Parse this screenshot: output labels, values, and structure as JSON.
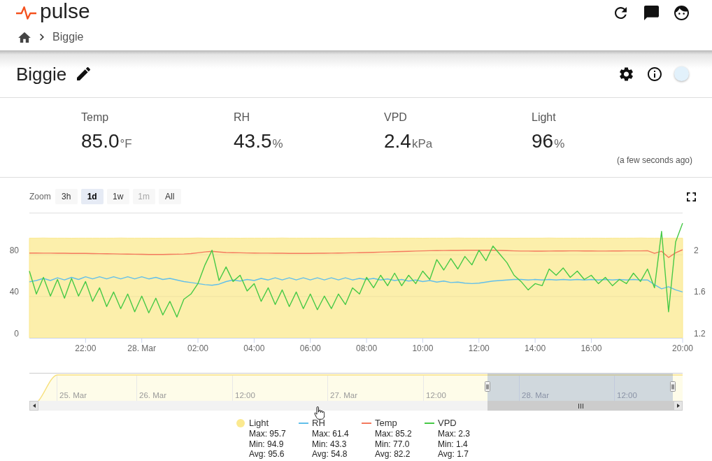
{
  "header": {
    "logo_text": "pulse",
    "breadcrumb": [
      "Biggie"
    ]
  },
  "device": {
    "title": "Biggie"
  },
  "readings": [
    {
      "label": "Temp",
      "value": "85.0",
      "unit": "°F"
    },
    {
      "label": "RH",
      "value": "43.5",
      "unit": "%"
    },
    {
      "label": "VPD",
      "value": "2.4",
      "unit": "kPa"
    },
    {
      "label": "Light",
      "value": "96",
      "unit": "%"
    }
  ],
  "updated": "(a few seconds ago)",
  "chart": {
    "zoom_label": "Zoom",
    "zoom_buttons": [
      {
        "label": "3h",
        "selected": false,
        "disabled": false
      },
      {
        "label": "1d",
        "selected": true,
        "disabled": false
      },
      {
        "label": "1w",
        "selected": false,
        "disabled": false
      },
      {
        "label": "1m",
        "selected": false,
        "disabled": true
      },
      {
        "label": "All",
        "selected": false,
        "disabled": false
      }
    ],
    "chart_data": {
      "type": "line",
      "categories": [
        null,
        null,
        null,
        null,
        null,
        null,
        null,
        null,
        "22:00",
        null,
        null,
        null,
        null,
        null,
        null,
        null,
        "28. Mar",
        null,
        null,
        null,
        null,
        null,
        null,
        null,
        "02:00",
        null,
        null,
        null,
        null,
        null,
        null,
        null,
        "04:00",
        null,
        null,
        null,
        null,
        null,
        null,
        null,
        "06:00",
        null,
        null,
        null,
        null,
        null,
        null,
        null,
        "08:00",
        null,
        null,
        null,
        null,
        null,
        null,
        null,
        "10:00",
        null,
        null,
        null,
        null,
        null,
        null,
        null,
        "12:00",
        null,
        null,
        null,
        null,
        null,
        null,
        null,
        "14:00",
        null,
        null,
        null,
        null,
        null,
        null,
        null,
        "16:00",
        null,
        null,
        null,
        null,
        null,
        null,
        null,
        null,
        null,
        null,
        null,
        null,
        "20:00"
      ],
      "ylim": [
        0,
        120
      ],
      "yticks": [
        0,
        40,
        80
      ],
      "y2lim": [
        1.2,
        2.4
      ],
      "y2ticks": [
        1.2,
        1.6,
        2
      ],
      "series": [
        {
          "name": "Light",
          "type": "area",
          "color": "#fbe98f",
          "values": [
            95.6,
            95.6,
            95.7,
            95.6,
            95.6,
            95.6,
            95.5,
            95.6,
            95.6,
            95.6,
            95.6,
            95.6,
            95.6,
            95.7,
            95.6,
            95.6,
            95.6,
            95.6,
            95.5,
            95.6,
            95.6,
            95.6,
            95.6,
            95.6,
            95.7,
            95.6,
            95.6,
            95.6,
            95.6,
            95.6,
            95.5,
            95.6,
            95.6,
            95.6,
            95.6,
            95.6,
            95.7,
            95.6,
            95.6,
            95.6,
            95.6,
            95.6,
            95.6,
            95.5,
            95.6,
            95.6,
            95.6,
            95.6,
            95.6,
            95.7,
            95.6,
            95.6,
            95.6,
            95.6,
            95.6,
            95.6,
            95.5,
            95.6,
            95.6,
            95.6,
            95.6,
            95.7,
            95.6,
            95.6,
            95.6,
            95.6,
            95.6,
            95.6,
            95.6,
            95.5,
            95.6,
            95.6,
            95.6,
            95.6,
            95.7,
            95.6,
            95.6,
            95.6,
            95.6,
            95.6,
            95.6,
            95.6,
            95.5,
            95.6,
            95.6,
            95.6,
            95.6,
            95.7,
            95.6,
            95.6,
            95.6,
            95.6,
            95.6,
            95.6
          ]
        },
        {
          "name": "RH",
          "type": "line",
          "color": "#62bfea",
          "values": [
            53.7,
            55,
            57,
            55,
            57.5,
            55.5,
            58,
            56,
            58.5,
            56.5,
            58.5,
            56.5,
            58.5,
            56.5,
            58.5,
            56.5,
            58.5,
            56.5,
            58,
            56,
            57,
            55.5,
            54,
            53,
            52,
            51,
            50.5,
            51.5,
            54,
            55.5,
            54.5,
            56,
            55,
            57,
            55.5,
            57.5,
            55.5,
            57.5,
            55.5,
            57.5,
            55.5,
            57.5,
            55.5,
            57.5,
            55.5,
            57.5,
            55.5,
            57,
            56,
            57,
            55.5,
            56.5,
            55,
            56,
            54.5,
            55.5,
            54,
            55,
            53.5,
            54.5,
            53,
            53.5,
            52.5,
            52,
            52.5,
            53.5,
            54.5,
            55,
            55.5,
            56,
            56,
            55.5,
            56,
            55.5,
            56,
            55.5,
            56,
            55.5,
            56,
            55.5,
            56,
            55.5,
            56,
            55.5,
            56,
            55.5,
            56,
            55.5,
            55.5,
            51,
            47,
            49,
            46,
            44
          ]
        },
        {
          "name": "Temp",
          "type": "line",
          "color": "#f47a5e",
          "values": [
            81.3,
            81.3,
            81.2,
            81.2,
            81.1,
            81.1,
            81.0,
            81.0,
            80.9,
            80.8,
            80.7,
            80.6,
            80.5,
            80.4,
            80.3,
            80.2,
            80.1,
            80.0,
            80.0,
            80.0,
            80.1,
            80.2,
            80.4,
            80.8,
            81.5,
            82.4,
            83.0,
            82.3,
            81.8,
            81.6,
            81.5,
            81.4,
            81.3,
            81.2,
            81.2,
            81.1,
            81.1,
            81.0,
            81.0,
            81.0,
            81.0,
            81.1,
            81.1,
            81.2,
            81.3,
            81.4,
            81.5,
            81.6,
            81.8,
            82.0,
            82.2,
            82.4,
            82.6,
            82.8,
            83.0,
            83.2,
            83.4,
            83.5,
            83.6,
            83.7,
            83.8,
            83.8,
            83.9,
            83.9,
            84.0,
            84.0,
            83.9,
            83.8,
            83.6,
            83.4,
            83.2,
            83.2,
            83.1,
            83.1,
            83.2,
            83.3,
            83.3,
            83.4,
            83.4,
            83.3,
            83.3,
            83.2,
            83.2,
            83.3,
            83.3,
            83.4,
            83.4,
            83.4,
            83.5,
            81.0,
            83.0,
            77.0,
            81.5,
            84.5
          ]
        },
        {
          "name": "VPD",
          "type": "line",
          "axis": "y2",
          "color": "#46c946",
          "values": [
            1.84,
            1.62,
            1.78,
            1.6,
            1.76,
            1.58,
            1.77,
            1.6,
            1.74,
            1.55,
            1.68,
            1.5,
            1.64,
            1.48,
            1.62,
            1.45,
            1.6,
            1.44,
            1.58,
            1.42,
            1.55,
            1.4,
            1.57,
            1.62,
            1.72,
            1.9,
            2.04,
            1.75,
            1.88,
            1.74,
            1.8,
            1.65,
            1.72,
            1.55,
            1.68,
            1.52,
            1.66,
            1.5,
            1.64,
            1.48,
            1.62,
            1.47,
            1.6,
            1.48,
            1.62,
            1.52,
            1.68,
            1.62,
            1.78,
            1.68,
            1.8,
            1.7,
            1.82,
            1.7,
            1.8,
            1.72,
            1.84,
            1.76,
            1.95,
            1.85,
            1.96,
            1.86,
            1.98,
            1.9,
            2.04,
            1.94,
            2.08,
            2.0,
            1.92,
            1.8,
            1.74,
            1.66,
            1.72,
            1.7,
            1.86,
            1.8,
            1.87,
            1.78,
            1.84,
            1.76,
            1.8,
            1.72,
            1.78,
            1.7,
            1.76,
            1.72,
            1.82,
            1.74,
            1.86,
            1.68,
            2.22,
            1.45,
            2.12,
            2.3
          ]
        }
      ]
    },
    "navigator": {
      "labels": [
        "25. Mar",
        "26. Mar",
        "12:00",
        "27. Mar",
        "12:00",
        "28. Mar",
        "12:00"
      ]
    },
    "legend": [
      {
        "stats": [
          "Max: 95.7",
          "Min: 94.9",
          "Avg: 95.6"
        ]
      },
      {
        "stats": [
          "Max: 61.4",
          "Min: 43.3",
          "Avg: 54.8"
        ]
      },
      {
        "stats": [
          "Max: 85.2",
          "Min: 77.0",
          "Avg: 82.2"
        ]
      },
      {
        "stats": [
          "Max: 2.3",
          "Min: 1.4",
          "Avg: 1.7"
        ]
      }
    ]
  }
}
